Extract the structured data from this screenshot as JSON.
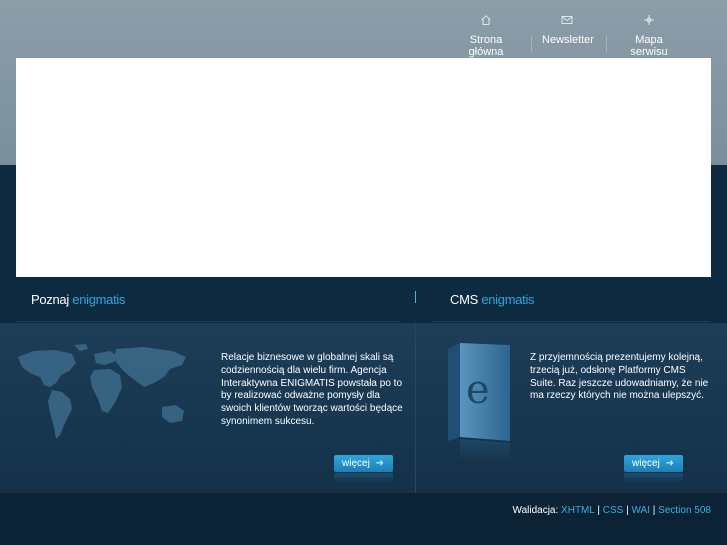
{
  "nav": {
    "items": [
      {
        "label": "Strona główna",
        "icon": "home-icon"
      },
      {
        "label": "Newsletter",
        "icon": "envelope-icon"
      },
      {
        "label": "Mapa serwisu",
        "icon": "sitemap-icon"
      }
    ]
  },
  "sections": {
    "left": {
      "title_plain": "Poznaj",
      "title_accent": "enigmatis",
      "text": "Relacje biznesowe w globalnej skali są codziennością dla wielu firm. Agencja Interaktywna ENIGMATIS powstała po to by realizować odważne pomysły dla swoich klientów tworząc wartości będące synonimem sukcesu.",
      "button": "więcej"
    },
    "right": {
      "title_plain": "CMS",
      "title_accent": "enigmatis",
      "text": "Z przyjemnością prezentujemy kolejną, trzecią już, odsłonę Platformy CMS Suite. Raz jeszcze udowadniamy, że nie ma rzeczy których nie można ulepszyć.",
      "button": "więcej",
      "box_letter": "e"
    }
  },
  "footer": {
    "label": "Walidacja:",
    "links": [
      "XHTML",
      "CSS",
      "WAI",
      "Section 508"
    ],
    "separator": "|"
  },
  "colors": {
    "accent": "#2ea6dc",
    "top_band": "#8b9ea9",
    "dark_bg": "#0e2a40"
  }
}
